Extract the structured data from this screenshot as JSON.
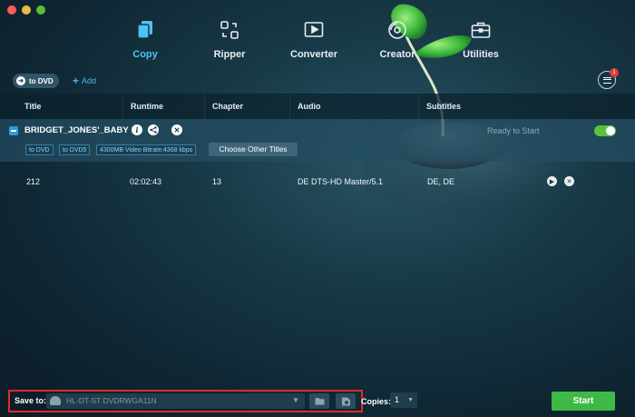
{
  "nav": {
    "items": [
      {
        "label": "Copy",
        "icon": "copy-icon",
        "active": true
      },
      {
        "label": "Ripper",
        "icon": "ripper-icon"
      },
      {
        "label": "Converter",
        "icon": "converter-icon"
      },
      {
        "label": "Creator",
        "icon": "creator-icon"
      },
      {
        "label": "Utilities",
        "icon": "toolbox-icon"
      }
    ]
  },
  "toolbar": {
    "target_label": "to DVD",
    "add_label": "Add",
    "task_badge": "1"
  },
  "table": {
    "headers": [
      "Title",
      "Runtime",
      "Chapter",
      "Audio",
      "Subtitles"
    ]
  },
  "disc": {
    "title": "BRIDGET_JONES'_BABY",
    "status": "Ready to Start",
    "enabled": true,
    "chips": [
      "to DVD",
      "to DVD5",
      "4300MB Video Bitrate:4368 kbps"
    ],
    "choose_label": "Choose Other Titles"
  },
  "titles": [
    {
      "title": "212",
      "runtime": "02:02:43",
      "chapter": "13",
      "audio": "DE  DTS-HD Master/5.1",
      "subtitles": "DE, DE"
    }
  ],
  "bottom": {
    "save_label": "Save to:",
    "save_value": "HL-DT-ST DVDRWGA11N",
    "copies_label": "Copies:",
    "copies_value": "1",
    "start_label": "Start"
  },
  "colors": {
    "accent": "#4fc3f7",
    "start": "#3fb845",
    "highlight_border": "#e02a2a"
  }
}
